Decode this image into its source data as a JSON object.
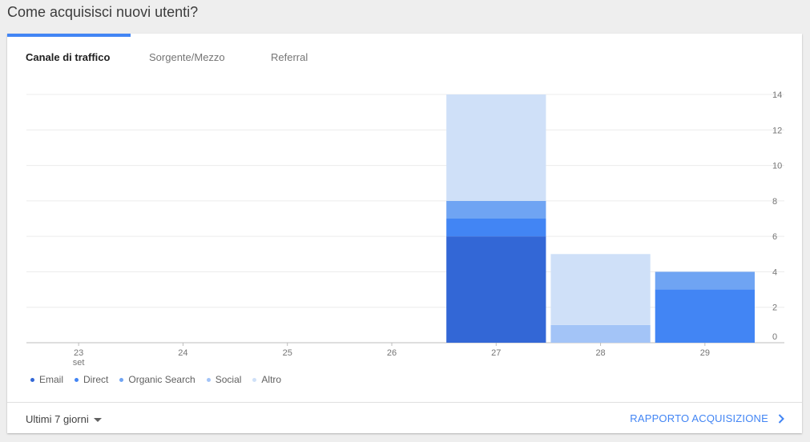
{
  "page_title": "Come acquisisci nuovi utenti?",
  "tabs": [
    {
      "label": "Canale di traffico",
      "active": true
    },
    {
      "label": "Sorgente/Mezzo",
      "active": false
    },
    {
      "label": "Referral",
      "active": false
    }
  ],
  "colors": {
    "accent": "#4285f4",
    "Email": "#3367d6",
    "Direct": "#4285f4",
    "Organic Search": "#6fa4f3",
    "Social": "#a3c4f7",
    "Altro": "#cfe0f8"
  },
  "chart_data": {
    "type": "bar",
    "stacked": true,
    "categories": [
      "23",
      "24",
      "25",
      "26",
      "27",
      "28",
      "29"
    ],
    "month_label": "set",
    "series": [
      {
        "name": "Email",
        "values": [
          0,
          0,
          0,
          0,
          6,
          0,
          0
        ]
      },
      {
        "name": "Direct",
        "values": [
          0,
          0,
          0,
          0,
          1,
          0,
          3
        ]
      },
      {
        "name": "Organic Search",
        "values": [
          0,
          0,
          0,
          0,
          1,
          0,
          1
        ]
      },
      {
        "name": "Social",
        "values": [
          0,
          0,
          0,
          0,
          0,
          1,
          0
        ]
      },
      {
        "name": "Altro",
        "values": [
          0,
          0,
          0,
          0,
          6,
          4,
          0
        ]
      }
    ],
    "y_ticks": [
      "0",
      "2",
      "4",
      "6",
      "8",
      "10",
      "12",
      "14"
    ],
    "ylim": [
      0,
      14
    ],
    "y_axis_side": "right",
    "grid": true,
    "legend_position": "bottom-left"
  },
  "footer": {
    "period_label": "Ultimi 7 giorni",
    "report_link": "RAPPORTO ACQUISIZIONE",
    "chevron_icon": "chevron-right-icon",
    "caret_icon": "caret-down-icon"
  }
}
